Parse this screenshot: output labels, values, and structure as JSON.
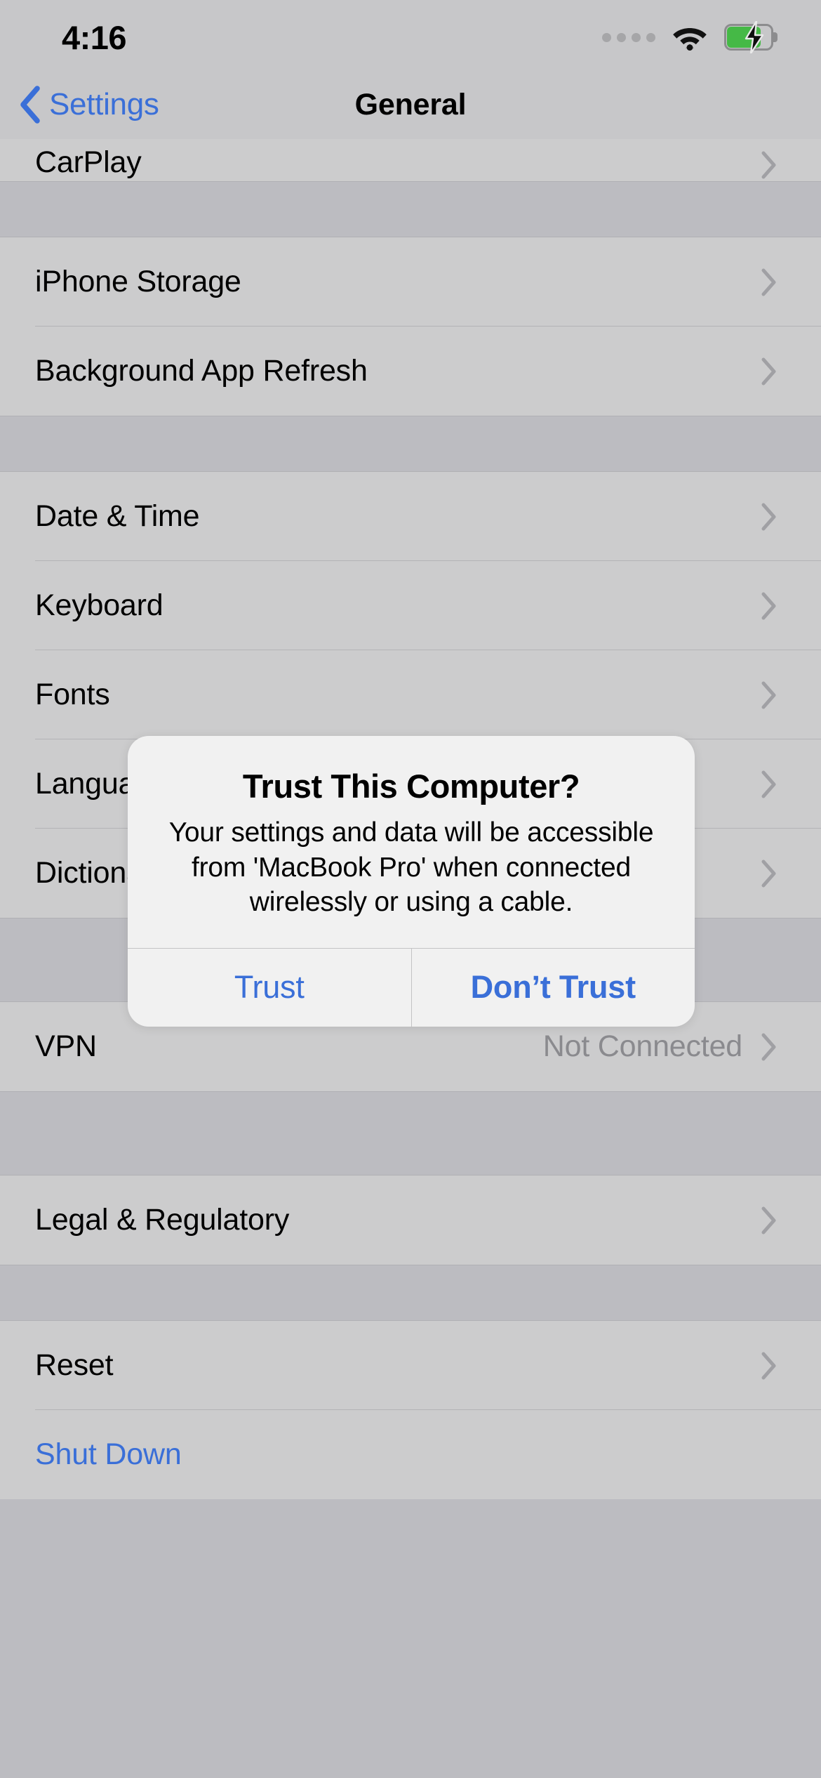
{
  "status_bar": {
    "time": "4:16",
    "signal_dots": 4,
    "wifi_icon": "wifi-icon",
    "battery_icon": "battery-charging-icon",
    "battery_charging": true,
    "battery_color": "#45b946"
  },
  "nav": {
    "back_label": "Settings",
    "back_icon": "chevron-left-icon",
    "title": "General"
  },
  "colors": {
    "accent_blue": "#3a6fd8",
    "list_background": "#cccccd",
    "page_background": "#bcbcc1",
    "value_gray": "#8a8a8e"
  },
  "list": {
    "groups": [
      {
        "name": "carplay-group",
        "clipped_top": true,
        "rows": [
          {
            "label": "CarPlay",
            "value": "",
            "accessory": "chevron-right-icon",
            "style": "default"
          }
        ]
      },
      {
        "name": "storage-group",
        "rows": [
          {
            "label": "iPhone Storage",
            "value": "",
            "accessory": "chevron-right-icon",
            "style": "default"
          },
          {
            "label": "Background App Refresh",
            "value": "",
            "accessory": "chevron-right-icon",
            "style": "default"
          }
        ]
      },
      {
        "name": "localization-group",
        "rows": [
          {
            "label": "Date & Time",
            "value": "",
            "accessory": "chevron-right-icon",
            "style": "default"
          },
          {
            "label": "Keyboard",
            "value": "",
            "accessory": "chevron-right-icon",
            "style": "default"
          },
          {
            "label": "Fonts",
            "value": "",
            "accessory": "chevron-right-icon",
            "style": "default"
          },
          {
            "label": "Language & Region",
            "value": "",
            "accessory": "chevron-right-icon",
            "style": "default"
          },
          {
            "label": "Dictionary",
            "value": "",
            "accessory": "chevron-right-icon",
            "style": "default"
          }
        ]
      },
      {
        "name": "vpn-group",
        "rows": [
          {
            "label": "VPN",
            "value": "Not Connected",
            "accessory": "chevron-right-icon",
            "style": "default"
          }
        ]
      },
      {
        "name": "legal-group",
        "rows": [
          {
            "label": "Legal & Regulatory",
            "value": "",
            "accessory": "chevron-right-icon",
            "style": "default"
          }
        ]
      },
      {
        "name": "reset-group",
        "rows": [
          {
            "label": "Reset",
            "value": "",
            "accessory": "chevron-right-icon",
            "style": "default"
          },
          {
            "label": "Shut Down",
            "value": "",
            "accessory": "",
            "style": "blue"
          }
        ]
      }
    ]
  },
  "alert": {
    "title": "Trust This Computer?",
    "message": "Your settings and data will be accessible from 'MacBook Pro' when connected wirelessly or using a cable.",
    "buttons": [
      {
        "label": "Trust",
        "emphasis": "normal"
      },
      {
        "label": "Don’t Trust",
        "emphasis": "bold"
      }
    ]
  }
}
